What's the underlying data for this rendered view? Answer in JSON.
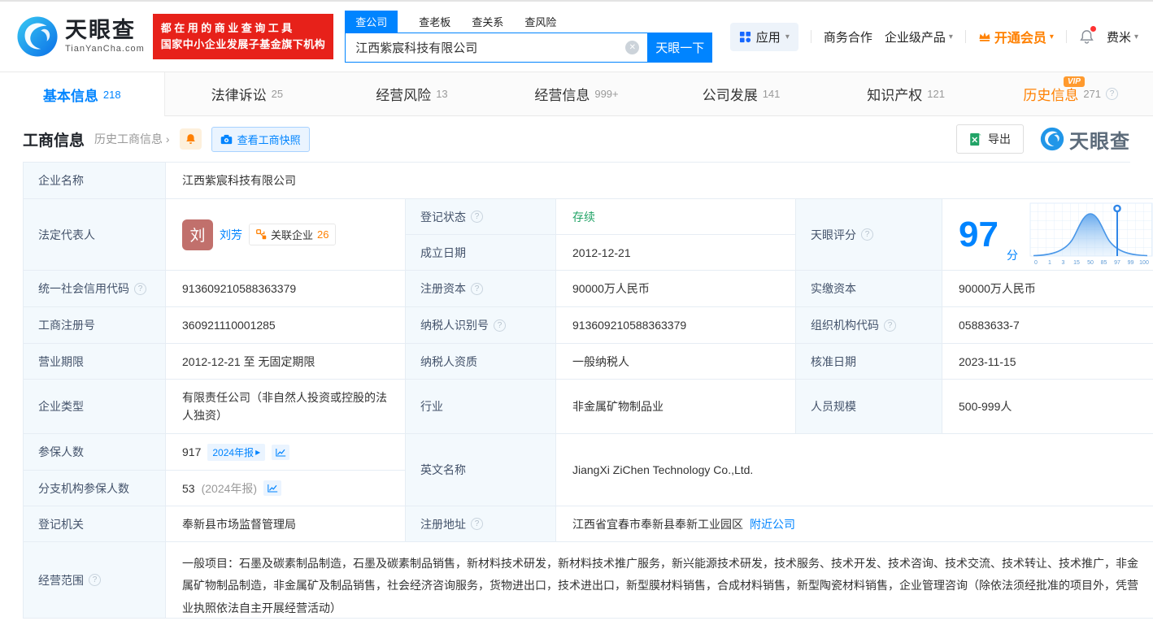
{
  "header": {
    "logo": {
      "brand": "天眼查",
      "domain": "TianYanCha.com"
    },
    "banner": {
      "line1": "都在用的商业查询工具",
      "line2": "国家中小企业发展子基金旗下机构"
    },
    "search": {
      "tabs": [
        "查公司",
        "查老板",
        "查关系",
        "查风险"
      ],
      "value": "江西紫宸科技有限公司",
      "button": "天眼一下"
    },
    "nav": {
      "apps": "应用",
      "coop": "商务合作",
      "enterprise": "企业级产品",
      "vip": "开通会员",
      "user": "费米"
    }
  },
  "tabs": [
    {
      "label": "基本信息",
      "count": "218"
    },
    {
      "label": "法律诉讼",
      "count": "25"
    },
    {
      "label": "经营风险",
      "count": "13"
    },
    {
      "label": "经营信息",
      "count": "999+"
    },
    {
      "label": "公司发展",
      "count": "141"
    },
    {
      "label": "知识产权",
      "count": "121"
    },
    {
      "label": "历史信息",
      "count": "271"
    }
  ],
  "section": {
    "title": "工商信息",
    "history_link": "历史工商信息",
    "snapshot_button": "查看工商快照",
    "export_button": "导出",
    "watermark": "天眼查"
  },
  "table": {
    "company_name_label": "企业名称",
    "company_name": "江西紫宸科技有限公司",
    "legal_rep_label": "法定代表人",
    "legal_rep_avatar": "刘",
    "legal_rep_name": "刘芳",
    "related_label": "关联企业",
    "related_count": "26",
    "reg_status_label": "登记状态",
    "reg_status": "存续",
    "establish_label": "成立日期",
    "establish_date": "2012-12-21",
    "score_label": "天眼评分",
    "score_value": "97",
    "score_unit": "分",
    "score_axis": [
      "0",
      "1",
      "3",
      "15",
      "50",
      "85",
      "97",
      "99",
      "100"
    ],
    "credit_code_label": "统一社会信用代码",
    "credit_code": "913609210588363379",
    "reg_capital_label": "注册资本",
    "reg_capital": "90000万人民币",
    "paid_capital_label": "实缴资本",
    "paid_capital": "90000万人民币",
    "reg_number_label": "工商注册号",
    "reg_number": "360921110001285",
    "taxpayer_id_label": "纳税人识别号",
    "taxpayer_id": "913609210588363379",
    "org_code_label": "组织机构代码",
    "org_code": "05883633-7",
    "business_term_label": "营业期限",
    "business_term": "2012-12-21 至 无固定期限",
    "taxpayer_quality_label": "纳税人资质",
    "taxpayer_quality": "一般纳税人",
    "approval_date_label": "核准日期",
    "approval_date": "2023-11-15",
    "company_type_label": "企业类型",
    "company_type": "有限责任公司（非自然人投资或控股的法人独资）",
    "industry_label": "行业",
    "industry": "非金属矿物制品业",
    "staff_size_label": "人员规模",
    "staff_size": "500-999人",
    "insured_label": "参保人数",
    "insured_count": "917",
    "insured_report": "2024年报",
    "branch_insured_label": "分支机构参保人数",
    "branch_insured": "53",
    "branch_insured_report": "(2024年报)",
    "english_name_label": "英文名称",
    "english_name": "JiangXi ZiChen Technology Co.,Ltd.",
    "reg_authority_label": "登记机关",
    "reg_authority": "奉新县市场监督管理局",
    "reg_address_label": "注册地址",
    "reg_address": "江西省宜春市奉新县奉新工业园区",
    "nearby_link": "附近公司",
    "business_scope_label": "经营范围",
    "business_scope": "一般项目：石墨及碳素制品制造，石墨及碳素制品销售，新材料技术研发，新材料技术推广服务，新兴能源技术研发，技术服务、技术开发、技术咨询、技术交流、技术转让、技术推广，非金属矿物制品制造，非金属矿及制品销售，社会经济咨询服务，货物进出口，技术进出口，新型膜材料销售，合成材料销售，新型陶瓷材料销售，企业管理咨询（除依法须经批准的项目外，凭营业执照依法自主开展经营活动）"
  },
  "icons": {
    "caret": "▾",
    "clear": "✕",
    "arrow": "›",
    "play": "▸",
    "question": "?",
    "vip": "VIP"
  },
  "colors": {
    "accent": "#0084ff",
    "orange": "#ff8000",
    "green": "#21a366",
    "banner_red": "#e7211a"
  }
}
